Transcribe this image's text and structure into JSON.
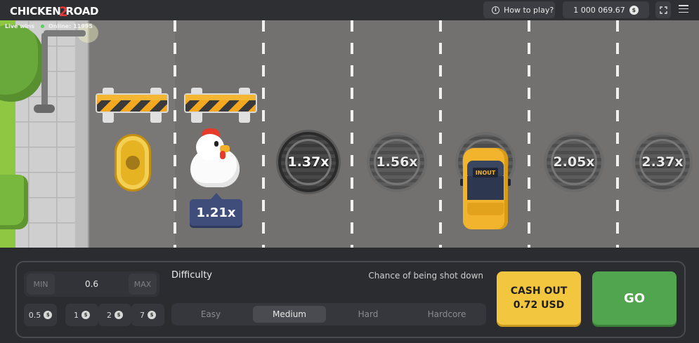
{
  "header": {
    "logo_part1": "CHICKEN",
    "logo_part2": "2",
    "logo_part3": "ROAD",
    "how_to_play": "How to play?",
    "balance": "1 000 069.67",
    "currency_symbol": "$"
  },
  "stats": {
    "live_wins": "Live wins",
    "online": "Online: 11995"
  },
  "road": {
    "current_multiplier": "1.21x",
    "lanes": [
      "1.37x",
      "1.56x",
      "",
      "2.05x",
      "2.37x"
    ],
    "car_sign": "INOUT"
  },
  "bet": {
    "min_label": "MIN",
    "max_label": "MAX",
    "value": "0.6",
    "chips": [
      "0.5",
      "1",
      "2",
      "7"
    ]
  },
  "difficulty": {
    "title": "Difficulty",
    "chance_label": "Chance of being shot down",
    "options": [
      "Easy",
      "Medium",
      "Hard",
      "Hardcore"
    ],
    "selected": "Medium"
  },
  "actions": {
    "cashout_line1": "CASH OUT",
    "cashout_line2": "0.72 USD",
    "go_label": "GO"
  },
  "colors": {
    "accent_yellow": "#f3c640",
    "go_green": "#51a54e",
    "multiplier_badge": "#3f4d7a"
  }
}
